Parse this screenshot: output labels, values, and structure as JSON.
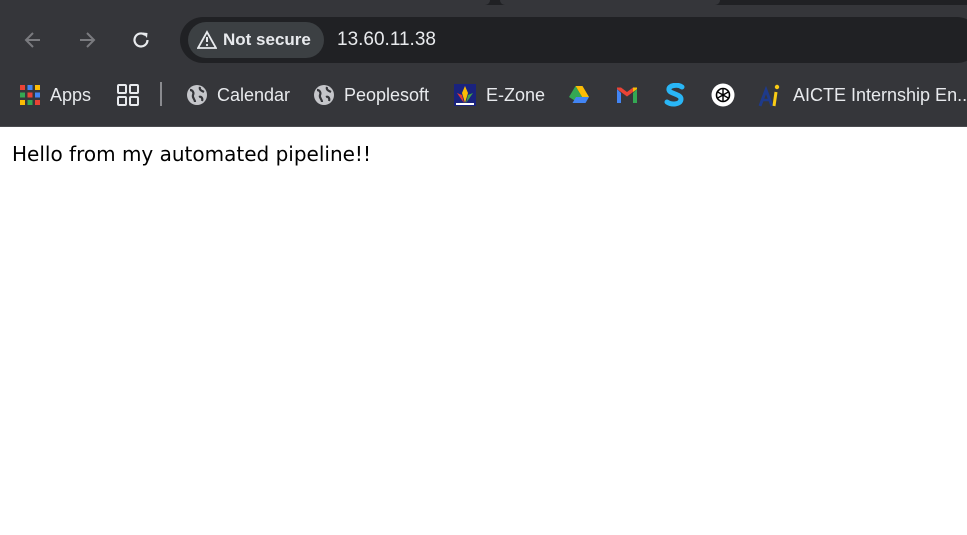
{
  "browser": {
    "security_label": "Not secure",
    "url": "13.60.11.38"
  },
  "bookmarks": {
    "apps_label": "Apps",
    "items": [
      {
        "label": "Calendar",
        "icon": "globe-icon"
      },
      {
        "label": "Peoplesoft",
        "icon": "globe-icon"
      },
      {
        "label": "E-Zone",
        "icon": "ezone-logo-icon"
      },
      {
        "label": "",
        "icon": "google-drive-icon"
      },
      {
        "label": "",
        "icon": "gmail-icon"
      },
      {
        "label": "",
        "icon": "s-logo-icon"
      },
      {
        "label": "",
        "icon": "chatgpt-icon"
      },
      {
        "label": "AICTE Internship En...",
        "icon": "aicte-logo-icon"
      }
    ]
  },
  "page": {
    "message": "Hello from my automated pipeline!!"
  },
  "colors": {
    "toolbar": "#35363a",
    "omnibox": "#202124",
    "text_light": "#e8eaed",
    "page_bg": "#ffffff"
  }
}
